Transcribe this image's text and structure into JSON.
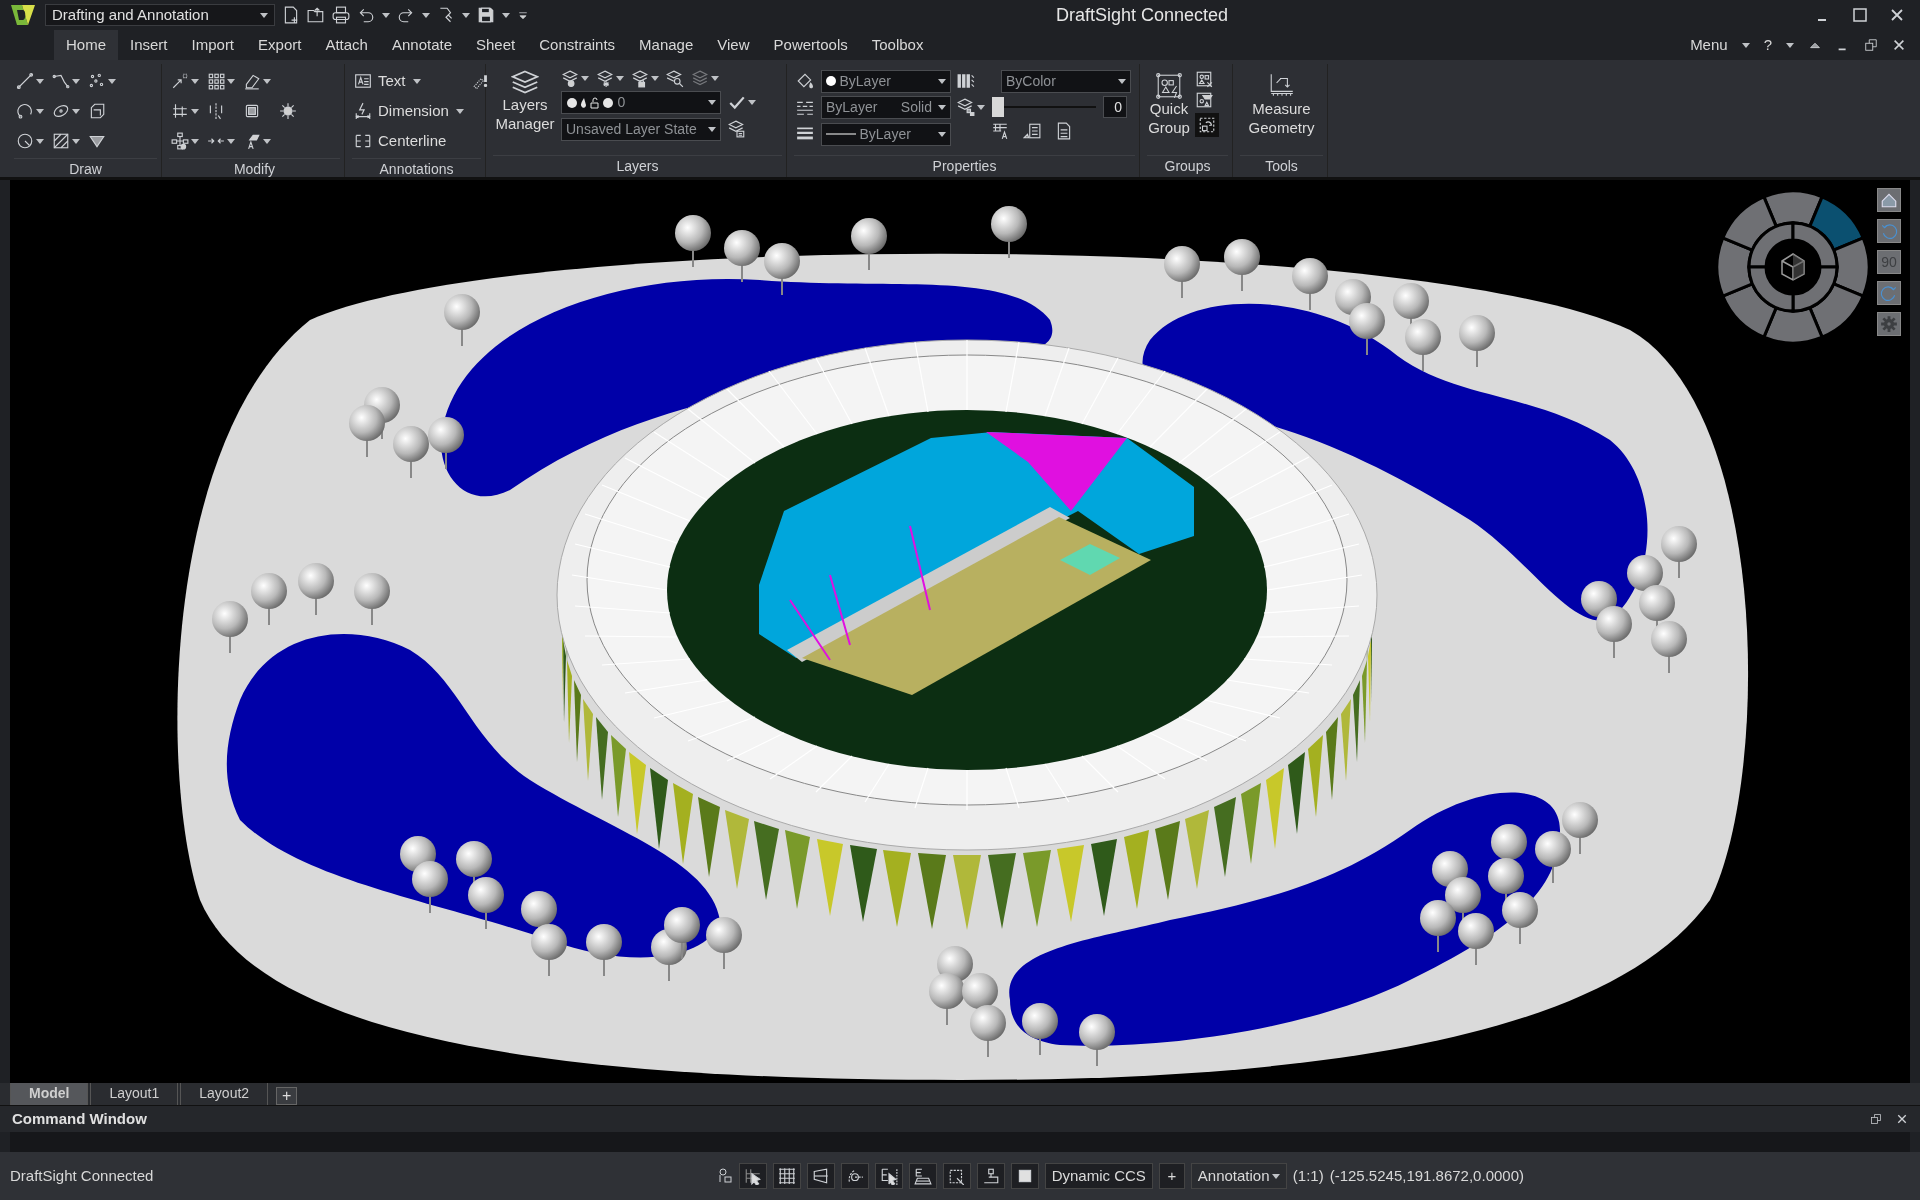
{
  "app": {
    "workspace": "Drafting and Annotation",
    "title": "DraftSight Connected"
  },
  "ribbon_tabs": [
    {
      "label": "Home",
      "selected": true
    },
    {
      "label": "Insert",
      "selected": false
    },
    {
      "label": "Import",
      "selected": false
    },
    {
      "label": "Export",
      "selected": false
    },
    {
      "label": "Attach",
      "selected": false
    },
    {
      "label": "Annotate",
      "selected": false
    },
    {
      "label": "Sheet",
      "selected": false
    },
    {
      "label": "Constraints",
      "selected": false
    },
    {
      "label": "Manage",
      "selected": false
    },
    {
      "label": "View",
      "selected": false
    },
    {
      "label": "Powertools",
      "selected": false
    },
    {
      "label": "Toolbox",
      "selected": false
    }
  ],
  "ribbon_menu": {
    "menu": "Menu",
    "help": "?"
  },
  "panels": {
    "draw": {
      "title": "Draw"
    },
    "modify": {
      "title": "Modify"
    },
    "annotations": {
      "title": "Annotations",
      "tools": [
        "Text",
        "Dimension",
        "Centerline"
      ]
    },
    "layers": {
      "title": "Layers",
      "manager": "Layers Manager",
      "layer": "0",
      "layer_state": "Unsaved Layer State"
    },
    "properties": {
      "title": "Properties",
      "color_setting": "ByLayer",
      "linetype": "ByLayer",
      "linetype_style": "Solid",
      "lineweight": "ByLayer",
      "plot_style": "ByColor",
      "transparency": {
        "level": 0,
        "reading": "0"
      }
    },
    "groups": {
      "title": "Groups",
      "quick_group": "Quick Group"
    },
    "tools": {
      "title": "Tools",
      "measure": "Measure Geometry"
    }
  },
  "nav_wheel": {
    "angle_button": "90"
  },
  "layout_tabs": [
    {
      "label": "Model",
      "selected": true
    },
    {
      "label": "Layout1",
      "selected": false
    },
    {
      "label": "Layout2",
      "selected": false
    }
  ],
  "add_tab": "+",
  "command_window": {
    "title": "Command Window"
  },
  "status_bar": {
    "message": "DraftSight Connected",
    "ccs": "Dynamic CCS",
    "add": "+",
    "annotation": "Annotation",
    "scale": "(1:1)",
    "coordinates": "(-125.5245,191.8672,0.0000)"
  }
}
